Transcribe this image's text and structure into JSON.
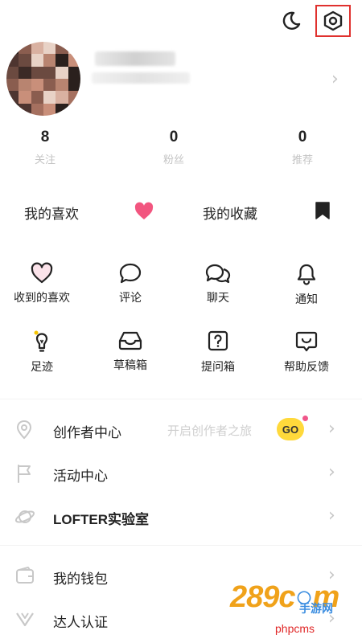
{
  "topbar": {
    "night_mode_icon": "moon-icon",
    "settings_icon": "gear-icon"
  },
  "stats": [
    {
      "value": "8",
      "label": "关注"
    },
    {
      "value": "0",
      "label": "粉丝"
    },
    {
      "value": "0",
      "label": "推荐"
    }
  ],
  "favorites": {
    "likes_label": "我的喜欢",
    "collect_label": "我的收藏",
    "heart_color": "#f2557f"
  },
  "grid": [
    {
      "label": "收到的喜欢",
      "icon": "heart-outline-icon"
    },
    {
      "label": "评论",
      "icon": "comment-bubble-icon"
    },
    {
      "label": "聊天",
      "icon": "chat-bubbles-icon"
    },
    {
      "label": "通知",
      "icon": "bell-icon"
    },
    {
      "label": "足迹",
      "icon": "footprint-bulb-icon"
    },
    {
      "label": "草稿箱",
      "icon": "inbox-tray-icon"
    },
    {
      "label": "提问箱",
      "icon": "question-box-icon"
    },
    {
      "label": "帮助反馈",
      "icon": "feedback-icon"
    }
  ],
  "menu": {
    "creator": {
      "label": "创作者中心",
      "hint": "开启创作者之旅",
      "badge": "GO"
    },
    "activity": {
      "label": "活动中心"
    },
    "lab": {
      "label": "LOFTER实验室"
    },
    "wallet": {
      "label": "我的钱包"
    },
    "certify": {
      "label": "达人认证"
    }
  },
  "watermark": {
    "logo": "289",
    "logo_tail": "c",
    "logo_end": "m",
    "sub": "手游网",
    "url": "phpcms"
  }
}
